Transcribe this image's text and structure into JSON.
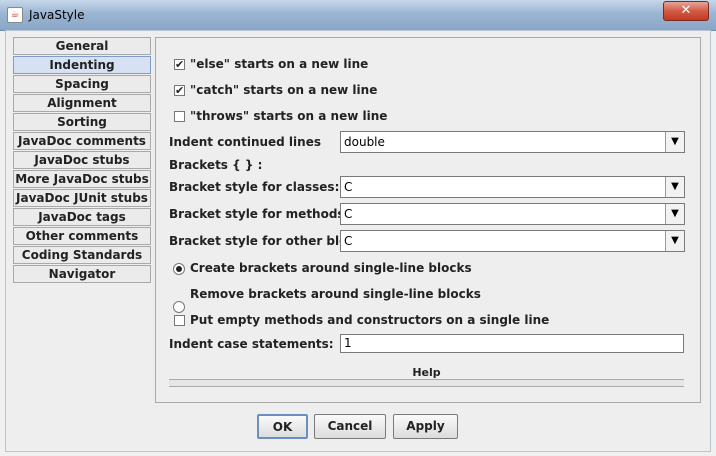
{
  "window": {
    "title": "JavaStyle",
    "close_label": "✕"
  },
  "tabs": [
    {
      "label": "General"
    },
    {
      "label": "Indenting"
    },
    {
      "label": "Spacing"
    },
    {
      "label": "Alignment"
    },
    {
      "label": "Sorting"
    },
    {
      "label": "JavaDoc comments"
    },
    {
      "label": "JavaDoc stubs"
    },
    {
      "label": "More JavaDoc stubs"
    },
    {
      "label": "JavaDoc JUnit stubs"
    },
    {
      "label": "JavaDoc tags"
    },
    {
      "label": "Other comments"
    },
    {
      "label": "Coding Standards"
    },
    {
      "label": "Navigator"
    }
  ],
  "indenting": {
    "else_newline": {
      "label": "\"else\" starts on a new line",
      "checked": true
    },
    "catch_newline": {
      "label": "\"catch\" starts on a new line",
      "checked": true
    },
    "throws_newline": {
      "label": "\"throws\" starts on a new line",
      "checked": false
    },
    "indent_continued": {
      "label": "Indent continued lines",
      "value": "double"
    },
    "brackets_heading": "Brackets { } :",
    "bracket_classes": {
      "label": "Bracket style for classes:",
      "value": "C"
    },
    "bracket_methods": {
      "label": "Bracket style for methods:",
      "value": "C"
    },
    "bracket_other": {
      "label": "Bracket style for other blocks:",
      "value": "C"
    },
    "create_brackets": {
      "label": "Create brackets around single-line blocks",
      "selected": true
    },
    "remove_brackets": {
      "label": "Remove brackets around single-line blocks",
      "selected": false
    },
    "empty_methods": {
      "label": "Put empty methods and constructors on a single line",
      "checked": false
    },
    "indent_case": {
      "label": "Indent case statements:",
      "value": "1"
    },
    "help_label": "Help"
  },
  "buttons": {
    "ok": "OK",
    "cancel": "Cancel",
    "apply": "Apply"
  }
}
